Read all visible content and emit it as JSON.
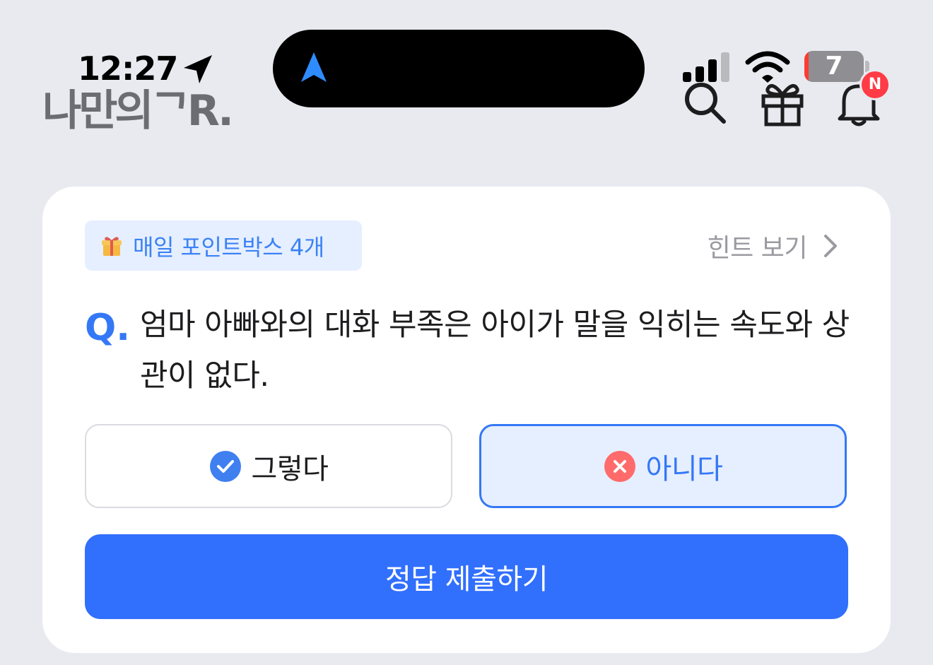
{
  "status_bar": {
    "time": "12:27",
    "battery": "7",
    "battery_level": 0.07,
    "location_icon": "location-arrow-icon",
    "navigation_icon": "navigation-arrow-icon",
    "signal_icon": "cellular-signal-icon",
    "wifi_icon": "wifi-icon"
  },
  "header": {
    "logo": "나만의ᄀR.",
    "search_icon": "search-icon",
    "gift_icon": "gift-icon",
    "bell_icon": "bell-icon",
    "notification_badge": "N"
  },
  "quiz": {
    "point_box_label": "매일 포인트박스 4개",
    "point_box_icon": "gift-box-icon",
    "hint_label": "힌트 보기",
    "q_mark": "Q.",
    "question": "엄마 아빠와의 대화 부족은 아이가 말을 익히는 속도와 상관이 없다.",
    "options": [
      {
        "label": "그렇다",
        "icon": "check-circle-icon",
        "selected": false
      },
      {
        "label": "아니다",
        "icon": "x-circle-icon",
        "selected": true
      }
    ],
    "submit_label": "정답 제출하기"
  },
  "colors": {
    "accent": "#316ffd",
    "selected_bg": "#e6efff",
    "badge": "#ff3b45",
    "wrong": "#ff6b6b",
    "correct": "#3b82f6"
  }
}
